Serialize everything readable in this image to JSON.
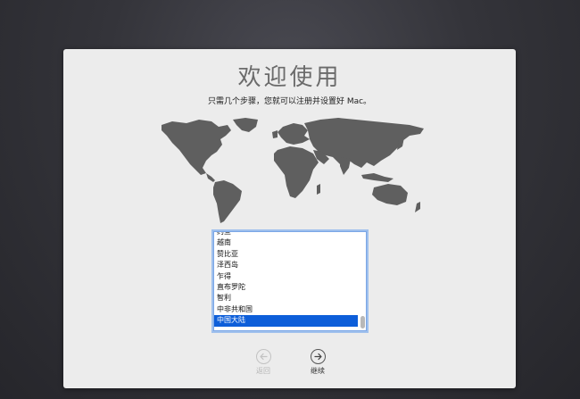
{
  "setup": {
    "title": "欢迎使用",
    "subtitle": "只需几个步骤，您就可以注册并设置好 Mac。"
  },
  "country_list": {
    "items": [
      {
        "label": "约旦",
        "selected": false
      },
      {
        "label": "越南",
        "selected": false
      },
      {
        "label": "赞比亚",
        "selected": false
      },
      {
        "label": "泽西岛",
        "selected": false
      },
      {
        "label": "乍得",
        "selected": false
      },
      {
        "label": "直布罗陀",
        "selected": false
      },
      {
        "label": "智利",
        "selected": false
      },
      {
        "label": "中非共和国",
        "selected": false
      },
      {
        "label": "中国大陆",
        "selected": true
      }
    ]
  },
  "buttons": {
    "back_label": "返回",
    "continue_label": "继续"
  },
  "colors": {
    "background": "#2e2e33",
    "panel": "#ececec",
    "map_land": "#5f5f5f",
    "selection": "#0d5ed9",
    "focus_ring": "#7aa6e6"
  },
  "icons": {
    "back": "arrow-left-icon",
    "continue": "arrow-right-icon"
  }
}
